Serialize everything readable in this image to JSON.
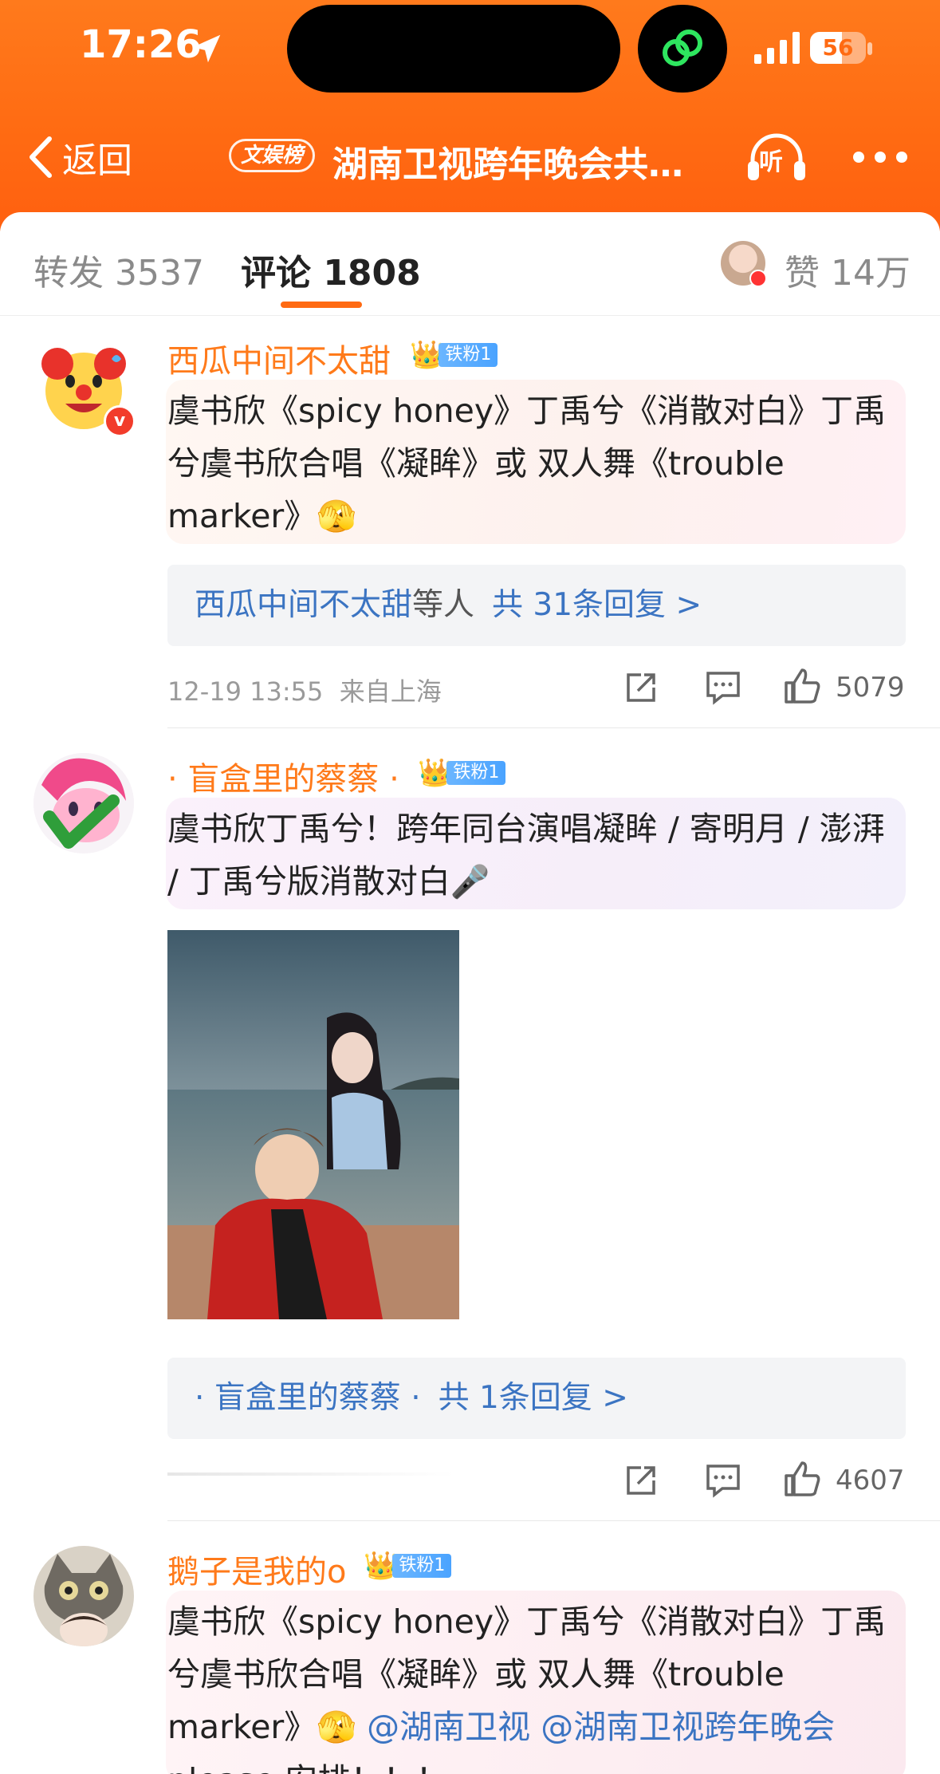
{
  "status": {
    "time": "17:26",
    "battery": "56"
  },
  "nav": {
    "back_label": "返回",
    "badge": "文娱榜",
    "title": "湖南卫视跨年晚会共…",
    "listen_label": "听"
  },
  "tabs": {
    "repost": "转发 3537",
    "comments": "评论 1808",
    "likes": "赞 14万"
  },
  "comments": [
    {
      "user": "西瓜中间不太甜",
      "fan_level": "铁粉1",
      "text": "虞书欣《spicy honey》丁禹兮《消散对白》丁禹兮虞书欣合唱《凝眸》或 双人舞《trouble marker》",
      "emoji": "🫣",
      "replies_user": "西瓜中间不太甜",
      "replies_etc": "等人",
      "replies_count": "共 31条回复 >",
      "time": "12-19 13:55",
      "location": "来自上海",
      "likes": "5079"
    },
    {
      "user": "· 盲盒里的蔡蔡 ·",
      "fan_level": "铁粉1",
      "text": "虞书欣丁禹兮！跨年同台演唱凝眸 / 寄明月 / 澎湃 / 丁禹兮版消散对白",
      "emoji": "🎤",
      "replies_user": "· 盲盒里的蔡蔡 ·",
      "replies_etc": "",
      "replies_count": "共 1条回复 >",
      "likes": "4607"
    },
    {
      "user": "鹅子是我的o",
      "fan_level": "铁粉1",
      "text": "虞书欣《spicy honey》丁禹兮《消散对白》丁禹兮虞书欣合唱《凝眸》或 双人舞《trouble marker》",
      "emoji": "🫣",
      "mention1": "@湖南卫视",
      "mention2": "@湖南卫视跨年晚会",
      "tail": "please 安排！！！"
    }
  ],
  "colors": {
    "accent": "#ff6a12",
    "link": "#3b74c2",
    "username": "#ff7a1a"
  },
  "icons": [
    "location-arrow-icon",
    "link-icon",
    "signal-icon",
    "battery-icon",
    "back-chevron-icon",
    "headphones-icon",
    "more-icon",
    "share-icon",
    "comment-icon",
    "like-icon",
    "crown-icon"
  ]
}
